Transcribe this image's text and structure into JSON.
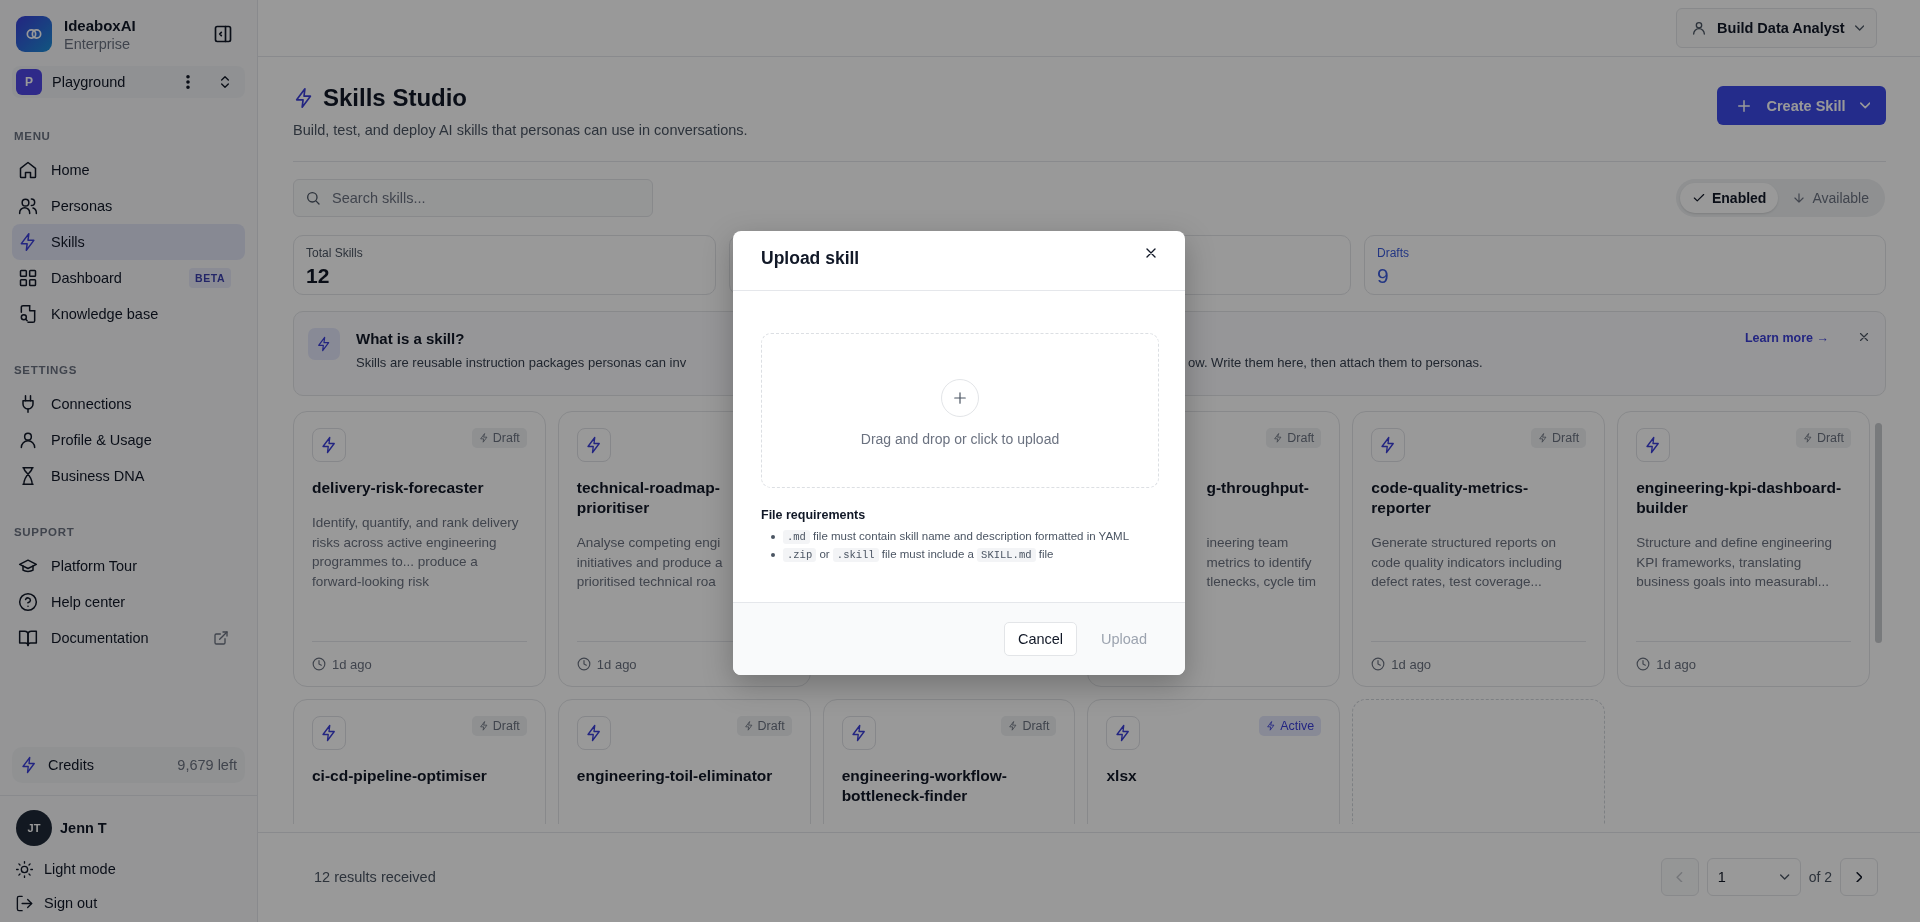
{
  "sidebar": {
    "brand": {
      "name": "IdeaboxAI",
      "subtitle": "Enterprise"
    },
    "workspace": {
      "initial": "P",
      "name": "Playground"
    },
    "sections": [
      {
        "heading": "MENU",
        "items": [
          {
            "label": "Home",
            "selected": false
          },
          {
            "label": "Personas",
            "selected": false
          },
          {
            "label": "Skills",
            "selected": true
          },
          {
            "label": "Dashboard",
            "selected": false,
            "badge": "BETA"
          },
          {
            "label": "Knowledge base",
            "selected": false
          }
        ]
      },
      {
        "heading": "SETTINGS",
        "items": [
          {
            "label": "Connections",
            "selected": false
          },
          {
            "label": "Profile & Usage",
            "selected": false
          },
          {
            "label": "Business DNA",
            "selected": false
          }
        ]
      },
      {
        "heading": "SUPPORT",
        "items": [
          {
            "label": "Platform Tour",
            "selected": false,
            "external": false
          },
          {
            "label": "Help center",
            "selected": false,
            "external": false
          },
          {
            "label": "Documentation",
            "selected": false,
            "external": true
          }
        ]
      }
    ],
    "credits": {
      "label": "Credits",
      "value": "9,679 left"
    },
    "user": {
      "initials": "JT",
      "name": "Jenn T"
    },
    "footer_links": [
      "Light mode",
      "Sign out"
    ]
  },
  "header": {
    "persona": "Build Data Analyst"
  },
  "page": {
    "title": "Skills Studio",
    "subtitle": "Build, test, and deploy AI skills that personas can use in conversations.",
    "create_button": "Create Skill"
  },
  "search": {
    "placeholder": "Search skills..."
  },
  "filter_tabs": [
    {
      "label": "Enabled",
      "selected": true
    },
    {
      "label": "Available",
      "selected": false
    }
  ],
  "stats": [
    {
      "label": "Total Skills",
      "value": "12",
      "kind": "total"
    },
    {
      "label": "Drafts",
      "value": "9",
      "kind": "drafts"
    }
  ],
  "info_banner": {
    "title": "What is a skill?",
    "text_left": "Skills are reusable instruction packages personas can inv",
    "text_right": "ow. Write them here, then attach them to personas.",
    "link": "Learn more →"
  },
  "cards": [
    {
      "kind": "full",
      "title": "delivery-risk-forecaster",
      "status": {
        "label": "Draft",
        "active": false
      },
      "description": "Identify, quantify, and rank delivery risks across active engineering programmes to... produce a forward-looking risk",
      "time": "1d ago"
    },
    {
      "kind": "covered-right",
      "title": "technical-roadmap-prioritiser",
      "description_lines": [
        "Analyse competing engi",
        "initiatives and produce a",
        "prioritised technical roa"
      ],
      "time": "1d ago"
    },
    {
      "kind": "covered-left",
      "title": "g-throughput-",
      "status": {
        "label": "Draft",
        "active": false
      },
      "description_lines": [
        "ineering team",
        "metrics to identify",
        "tlenecks, cycle tim"
      ]
    },
    {
      "kind": "full",
      "title": "code-quality-metrics-reporter",
      "status": {
        "label": "Draft",
        "active": false
      },
      "description": "Generate structured reports on code quality indicators including defect rates, test coverage...",
      "time": "1d ago"
    },
    {
      "kind": "full",
      "title": "engineering-kpi-dashboard-builder",
      "status": {
        "label": "Draft",
        "active": false
      },
      "description": "Structure and define engineering KPI frameworks, translating business goals into measurabl...",
      "time": "1d ago"
    },
    {
      "kind": "full",
      "title": "ci-cd-pipeline-optimiser",
      "status": {
        "label": "Draft",
        "active": false
      }
    },
    {
      "kind": "full",
      "title": "engineering-toil-eliminator",
      "status": {
        "label": "Draft",
        "active": false
      }
    },
    {
      "kind": "full",
      "title": "engineering-workflow-bottleneck-finder",
      "status": {
        "label": "Draft",
        "active": false
      }
    },
    {
      "kind": "full",
      "title": "xlsx",
      "status": {
        "label": "Active",
        "active": true
      }
    },
    {
      "kind": "add"
    }
  ],
  "footer": {
    "results": "12 results received",
    "page": "1",
    "page_count": "of 2"
  },
  "modal": {
    "title": "Upload skill",
    "dropzone": "Drag and drop or click to upload",
    "requirements_title": "File requirements",
    "requirements": [
      [
        {
          "kind": "code",
          "text": ".md"
        },
        {
          "kind": "text",
          "text": " file must contain skill name and description formatted in YAML"
        }
      ],
      [
        {
          "kind": "code",
          "text": ".zip"
        },
        {
          "kind": "text",
          "text": " or "
        },
        {
          "kind": "code",
          "text": ".skill"
        },
        {
          "kind": "text",
          "text": " file must include a "
        },
        {
          "kind": "code",
          "text": "SKILL.md"
        },
        {
          "kind": "text",
          "text": " file"
        }
      ]
    ],
    "buttons": [
      {
        "label": "Cancel",
        "disabled": false
      },
      {
        "label": "Upload",
        "disabled": true
      }
    ]
  }
}
